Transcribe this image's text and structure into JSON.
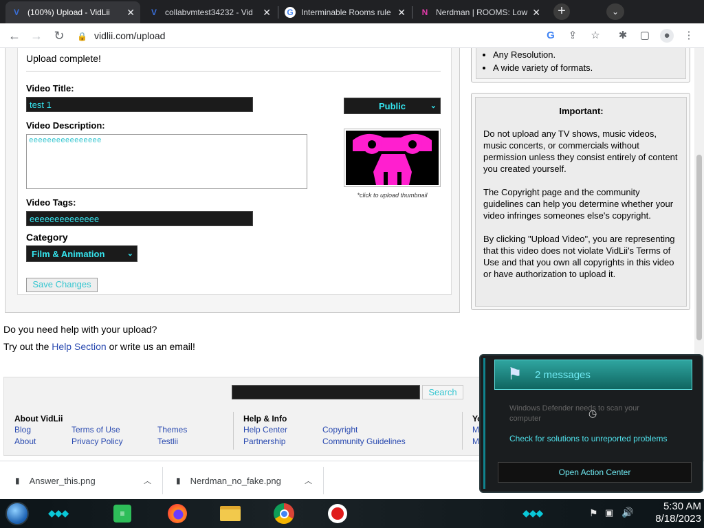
{
  "browser": {
    "tabs": [
      {
        "title": "(100%) Upload - VidLii",
        "favicon": "V"
      },
      {
        "title": "collabvmtest34232 - Vid",
        "favicon": "V"
      },
      {
        "title": "Interminable Rooms rule",
        "favicon": "G"
      },
      {
        "title": "Nerdman | ROOMS: Low",
        "favicon": "N"
      }
    ],
    "url": "vidlii.com/upload",
    "new_tab": "+",
    "tab_search": "⌄"
  },
  "upload": {
    "status": "Upload complete!",
    "title_label": "Video Title:",
    "title_value": "test 1",
    "privacy_value": "Public",
    "description_label": "Video Description:",
    "description_value": "eeeeeeeeeeeeeeee",
    "thumb_caption": "*click to upload thumbnail",
    "tags_label": "Video Tags:",
    "tags_value": "eeeeeeeeeeeeee",
    "category_label": "Category",
    "category_value": "Film & Animation",
    "save_label": "Save Changes"
  },
  "sidebar": {
    "list_items": [
      "Any Resolution.",
      "A wide variety of formats."
    ],
    "important_title": "Important:",
    "paragraphs": [
      "Do not upload any TV shows, music videos, music concerts, or commercials without permission unless they consist entirely of content you created yourself.",
      "The Copyright page and the community guidelines can help you determine whether your video infringes someones else's copyright.",
      "By clicking \"Upload Video\", you are representing that this video does not violate VidLii's Terms of Use and that you own all copyrights in this video or have authorization to upload it."
    ]
  },
  "help": {
    "question": "Do you need help with your upload?",
    "prefix": "Try out the ",
    "link": "Help Section",
    "suffix": " or write us an email!"
  },
  "footer": {
    "search_label": "Search",
    "about_header": "About VidLii",
    "about_links": [
      "Blog",
      "Terms of Use",
      "Themes",
      "About",
      "Privacy Policy",
      "Testlii"
    ],
    "help_header": "Help & Info",
    "help_links": [
      "Help Center",
      "Copyright",
      "Partnership",
      "Community Guidelines"
    ],
    "you_header": "Yo",
    "you_links": [
      "My",
      "M"
    ]
  },
  "downloads": [
    {
      "name": "Answer_this.png"
    },
    {
      "name": "Nerdman_no_fake.png"
    }
  ],
  "notification": {
    "title": "2 messages",
    "defender_text": "Windows Defender needs to scan your computer",
    "solutions_link": "Check for solutions to unreported problems",
    "action_center": "Open Action Center"
  },
  "taskbar": {
    "time": "5:30 AM",
    "date": "8/18/2023"
  },
  "colors": {
    "accent_cyan": "#35e6f0",
    "link_blue": "#2a4ab0",
    "dark_input": "#1b1b1b"
  }
}
